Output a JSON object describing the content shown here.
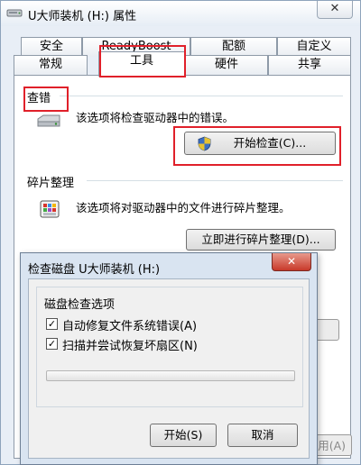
{
  "window": {
    "title": "U大师装机 (H:) 属性",
    "close_glyph": "✕"
  },
  "tabs": {
    "row1": [
      "安全",
      "ReadyBoost",
      "配额",
      "自定义"
    ],
    "row2": [
      "常规",
      "工具",
      "硬件",
      "共享"
    ],
    "active": "工具"
  },
  "error_check": {
    "title": "查错",
    "description": "该选项将检查驱动器中的错误。",
    "button": "开始检查(C)..."
  },
  "defrag": {
    "title": "碎片整理",
    "description": "该选项将对驱动器中的文件进行碎片整理。",
    "button": "立即进行碎片整理(D)..."
  },
  "covered": {
    "apply_fragment": "用(A)"
  },
  "dialog": {
    "title": "检查磁盘 U大师装机 (H:)",
    "close_glyph": "✕",
    "options_title": "磁盘检查选项",
    "options": [
      {
        "label": "自动修复文件系统错误(A)",
        "checked": true
      },
      {
        "label": "扫描并尝试恢复坏扇区(N)",
        "checked": true
      }
    ],
    "progress": 0,
    "start_button": "开始(S)",
    "cancel_button": "取消"
  },
  "colors": {
    "highlight_box": "#e0202a",
    "progress_fill": "#4cc14c"
  }
}
